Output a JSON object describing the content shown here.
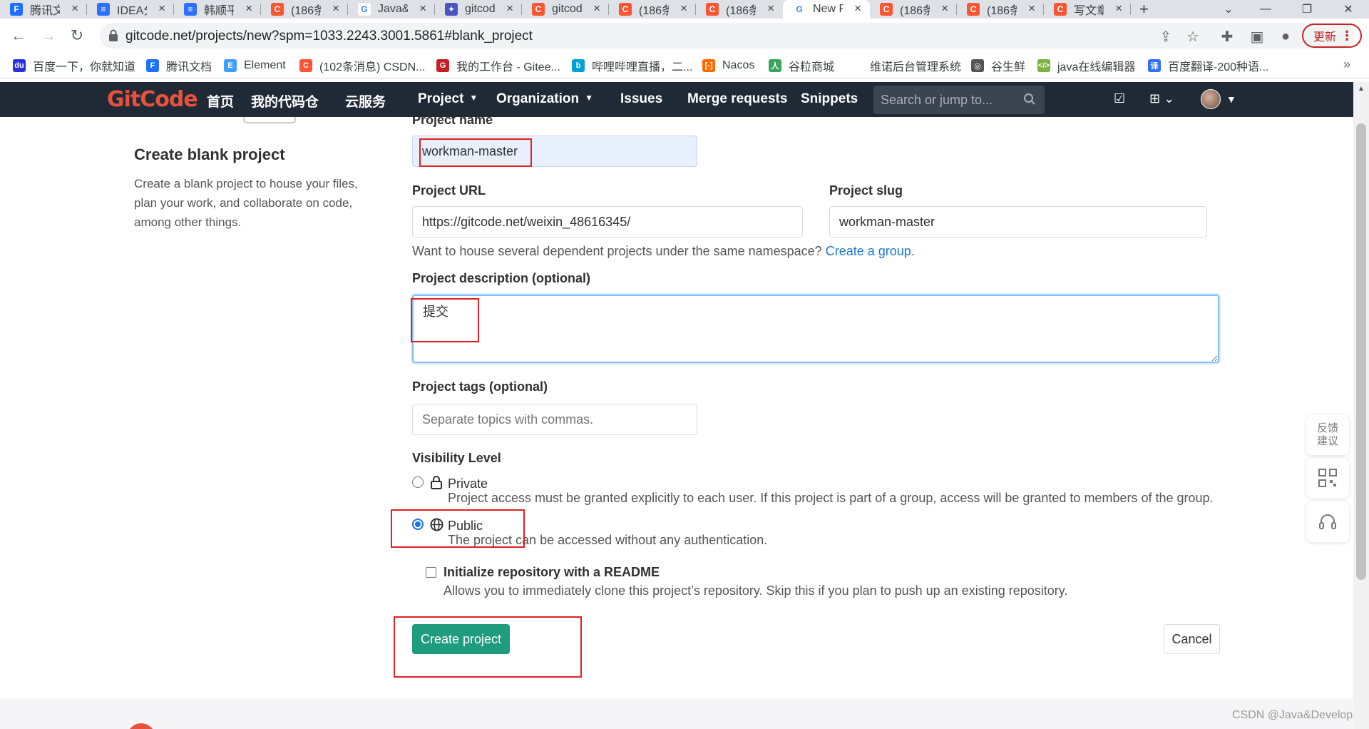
{
  "browser": {
    "tabs": [
      {
        "title": "腾讯文档",
        "color": "#1e6fff",
        "glyph": "F"
      },
      {
        "title": "IDEA分支",
        "color": "#2f6fff",
        "glyph": "≡"
      },
      {
        "title": "韩顺平",
        "color": "#2f6fff",
        "glyph": "≡"
      },
      {
        "title": "(186条",
        "color": "#fc5531",
        "glyph": "C"
      },
      {
        "title": "Java&",
        "color": "#fff",
        "glyph": "G"
      },
      {
        "title": "gitcode",
        "color": "#4a55c2",
        "glyph": "✦"
      },
      {
        "title": "gitcode",
        "color": "#fc5531",
        "glyph": "C"
      },
      {
        "title": "(186条",
        "color": "#fc5531",
        "glyph": "C"
      },
      {
        "title": "(186条",
        "color": "#fc5531",
        "glyph": "C"
      },
      {
        "title": "New P",
        "color": "#fff",
        "glyph": "G"
      },
      {
        "title": "(186条",
        "color": "#fc5531",
        "glyph": "C"
      },
      {
        "title": "(186条",
        "color": "#fc5531",
        "glyph": "C"
      },
      {
        "title": "写文章",
        "color": "#fc5531",
        "glyph": "C"
      }
    ],
    "new_tab": "+",
    "url": "gitcode.net/projects/new?spm=1033.2243.3001.5861#blank_project",
    "update_label": "更新",
    "bookmarks": [
      {
        "label": "百度一下，你就知道",
        "color": "#2932e1",
        "glyph": "du"
      },
      {
        "label": "腾讯文档",
        "color": "#1e6fff",
        "glyph": "F"
      },
      {
        "label": "Element",
        "color": "#409eff",
        "glyph": "E"
      },
      {
        "label": "(102条消息) CSDN...",
        "color": "#fc5531",
        "glyph": "C"
      },
      {
        "label": "我的工作台 - Gitee...",
        "color": "#c71d23",
        "glyph": "G"
      },
      {
        "label": "哔哩哔哩直播，二...",
        "color": "#00a1d6",
        "glyph": "b"
      },
      {
        "label": "Nacos",
        "color": "#ff6a00",
        "glyph": "[-]"
      },
      {
        "label": "谷粒商城",
        "color": "#3ba55c",
        "glyph": "人"
      },
      {
        "label": "维诺后台管理系统",
        "color": "",
        "glyph": ""
      },
      {
        "label": "谷生鲜",
        "color": "#555",
        "glyph": "◎"
      },
      {
        "label": "java在线编辑器",
        "color": "#7cb342",
        "glyph": "</>"
      },
      {
        "label": "百度翻译-200种语...",
        "color": "#2f6fff",
        "glyph": "译"
      }
    ],
    "bookmarks_more": "»"
  },
  "navbar": {
    "logo": "GitCode",
    "items": [
      "首页",
      "我的代码仓",
      "云服务",
      "Project",
      "Organization",
      "Issues",
      "Merge requests",
      "Snippets"
    ],
    "search_placeholder": "Search or jump to..."
  },
  "sidebar": {
    "title": "Create blank project",
    "description": "Create a blank project to house your files, plan your work, and collaborate on code, among other things."
  },
  "form": {
    "project_name_label": "Project name",
    "project_name_value": "workman-master",
    "project_url_label": "Project URL",
    "project_url_value": "https://gitcode.net/weixin_48616345/",
    "project_slug_label": "Project slug",
    "project_slug_value": "workman-master",
    "namespace_help": "Want to house several dependent projects under the same namespace?",
    "create_group_link": "Create a group.",
    "description_label": "Project description (optional)",
    "description_value": "提交",
    "tags_label": "Project tags (optional)",
    "tags_placeholder": "Separate topics with commas.",
    "visibility_label": "Visibility Level",
    "private_label": "Private",
    "private_help": "Project access must be granted explicitly to each user. If this project is part of a group, access will be granted to members of the group.",
    "public_label": "Public",
    "public_help": "The project can be accessed without any authentication.",
    "readme_label": "Initialize repository with a README",
    "readme_help": "Allows you to immediately clone this project’s repository. Skip this if you plan to push up an existing repository.",
    "create_button": "Create project",
    "cancel_button": "Cancel",
    "visibility_selected": "Public",
    "readme_checked": false
  },
  "side_widgets": {
    "feedback": "反馈建议"
  },
  "watermark": "CSDN @Java&Develop",
  "colors": {
    "navbar_bg": "#1f2a36",
    "brand": "#e8513c",
    "create_button": "#1f9b7d",
    "link": "#1f78d1",
    "annotation": "#e02020"
  }
}
